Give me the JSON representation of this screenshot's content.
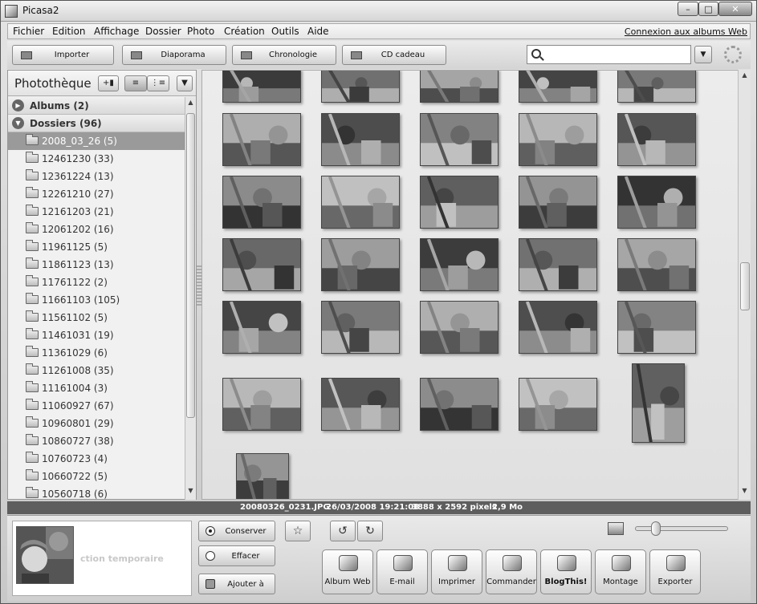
{
  "window": {
    "title": "Picasa2"
  },
  "menu": [
    "Fichier",
    "Edition",
    "Affichage",
    "Dossier",
    "Photo",
    "Création",
    "Outils",
    "Aide"
  ],
  "web_link": "Connexion aux albums Web",
  "toolbar": {
    "import": "Importer",
    "slideshow": "Diaporama",
    "timeline": "Chronologie",
    "gift_cd": "CD cadeau",
    "search_value": ""
  },
  "library": {
    "title": "Photothèque",
    "sections": {
      "albums": "Albums (2)",
      "folders": "Dossiers (96)"
    },
    "folders": [
      "2008_03_26 (5)",
      "12461230 (33)",
      "12361224 (13)",
      "12261210 (27)",
      "12161203 (21)",
      "12061202 (16)",
      "11961125 (5)",
      "11861123 (13)",
      "11761122 (2)",
      "11661103 (105)",
      "11561102 (5)",
      "11461031 (19)",
      "11361029 (6)",
      "11261008 (35)",
      "11161004 (3)",
      "11060927 (67)",
      "10960801 (29)",
      "10860727 (38)",
      "10760723 (4)",
      "10660722 (5)",
      "10560718 (6)"
    ]
  },
  "status": {
    "filename": "20080326_0231.JPG",
    "datetime": "26/03/2008 19:21:08",
    "dimensions": "3888 x 2592 pixels",
    "size": "2,9 Mo"
  },
  "tray": {
    "label": "ction temporaire",
    "hold": "Conserver",
    "clear": "Effacer",
    "add_to": "Ajouter à"
  },
  "actions": [
    "Album Web",
    "E-mail",
    "Imprimer",
    "Commander",
    "BlogThis!",
    "Montage",
    "Exporter"
  ]
}
